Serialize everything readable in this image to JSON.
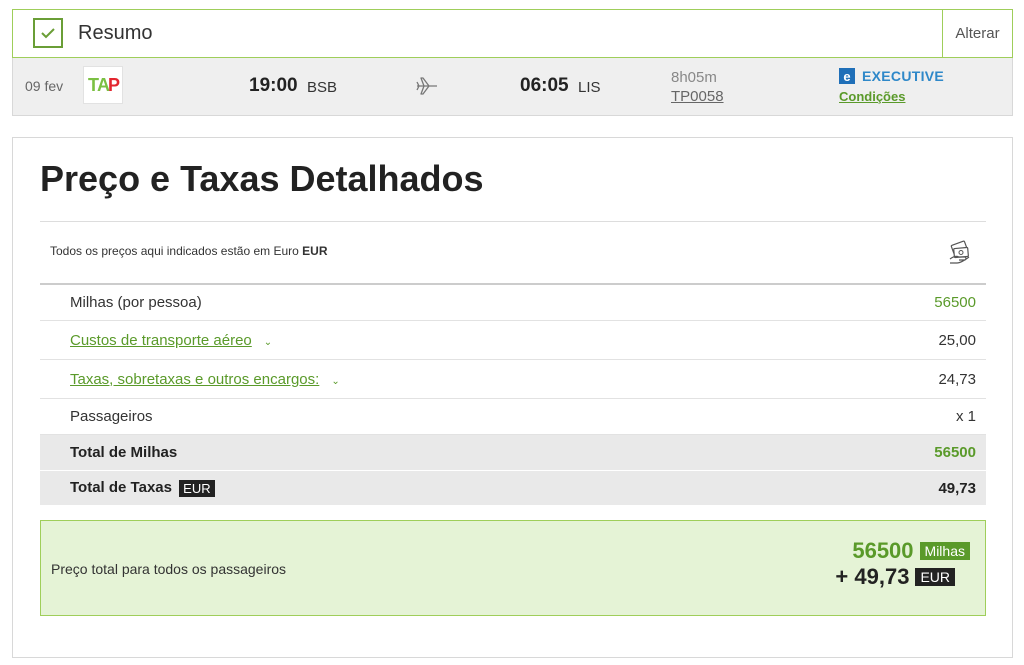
{
  "summary": {
    "title": "Resumo",
    "edit_label": "Alterar"
  },
  "flight": {
    "date": "09 fev",
    "airline_logo": {
      "t": "T",
      "a": "A",
      "p": "P"
    },
    "departure_time": "19:00",
    "departure_code": "BSB",
    "arrival_time": "06:05",
    "arrival_code": "LIS",
    "duration": "8h05m",
    "flight_number": "TP0058",
    "cabin_icon": "e",
    "cabin": "EXECUTIVE",
    "conditions": "Condições"
  },
  "details": {
    "title": "Preço e Taxas Detalhados",
    "note_prefix": "Todos os preços aqui indicados estão em Euro",
    "note_currency": "EUR",
    "rows": [
      {
        "label": "Milhas (por pessoa)",
        "value": "56500"
      },
      {
        "label": "Custos de transporte aéreo",
        "value": "25,00"
      },
      {
        "label": "Taxas, sobretaxas e outros encargos:",
        "value": "24,73"
      },
      {
        "label": "Passageiros",
        "value": "x 1"
      }
    ],
    "total_miles": {
      "label": "Total de Milhas",
      "value": "56500"
    },
    "total_taxes": {
      "label": "Total de Taxas",
      "currency": "EUR",
      "value": "49,73"
    }
  },
  "total": {
    "label": "Preço total para todos os passageiros",
    "miles": "56500",
    "miles_unit": "Milhas",
    "taxes": "+ 49,73",
    "taxes_currency": "EUR"
  },
  "colors": {
    "accent": "#5a9a2a",
    "border": "#9fce5a",
    "total_bg": "#e5f3d6",
    "cabin": "#2e88c9"
  }
}
